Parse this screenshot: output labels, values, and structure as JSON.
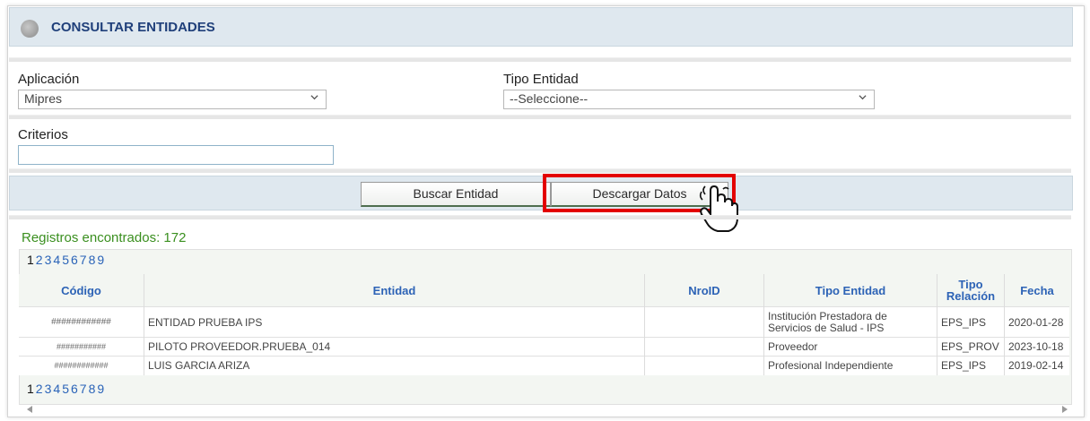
{
  "header": {
    "title": "CONSULTAR ENTIDADES"
  },
  "filters": {
    "aplicacion_label": "Aplicación",
    "aplicacion_value": "Mipres",
    "tipo_entidad_label": "Tipo Entidad",
    "tipo_entidad_value": "--Seleccione--",
    "criterios_label": "Criterios",
    "criterios_value": ""
  },
  "buttons": {
    "buscar": "Buscar Entidad",
    "descargar": "Descargar Datos"
  },
  "results": {
    "found_text": "Registros encontrados: 172",
    "pages": [
      "1",
      "2",
      "3",
      "4",
      "5",
      "6",
      "7",
      "8",
      "9"
    ],
    "current_page": "1"
  },
  "table": {
    "headers": [
      "Código",
      "Entidad",
      "NroID",
      "Tipo Entidad",
      "Tipo Relación",
      "Fecha"
    ],
    "header_tipo_relacion_line1": "Tipo",
    "header_tipo_relacion_line2": "Relación",
    "rows": [
      {
        "codigo": "############",
        "entidad": "ENTIDAD PRUEBA IPS",
        "nroid": "",
        "tipo_entidad_1": "Institución Prestadora de",
        "tipo_entidad_2": "Servicios de Salud - IPS",
        "tipo_relacion": "EPS_IPS",
        "fecha": "2020-01-28"
      },
      {
        "codigo": "###########",
        "entidad": "PILOTO PROVEEDOR.PRUEBA_014",
        "nroid": "",
        "tipo_entidad_1": "Proveedor",
        "tipo_entidad_2": "",
        "tipo_relacion": "EPS_PROV",
        "fecha": "2023-10-18"
      },
      {
        "codigo": "############",
        "entidad": "LUIS GARCIA ARIZA",
        "nroid": "",
        "tipo_entidad_1": "Profesional Independiente",
        "tipo_entidad_2": "",
        "tipo_relacion": "EPS_IPS",
        "fecha": "2019-02-14"
      }
    ]
  },
  "colors": {
    "header_bg": "#dfe8ef",
    "title": "#1f3f7a",
    "highlight": "#e30000",
    "found": "#3a8f1f",
    "link": "#2a63b8"
  }
}
